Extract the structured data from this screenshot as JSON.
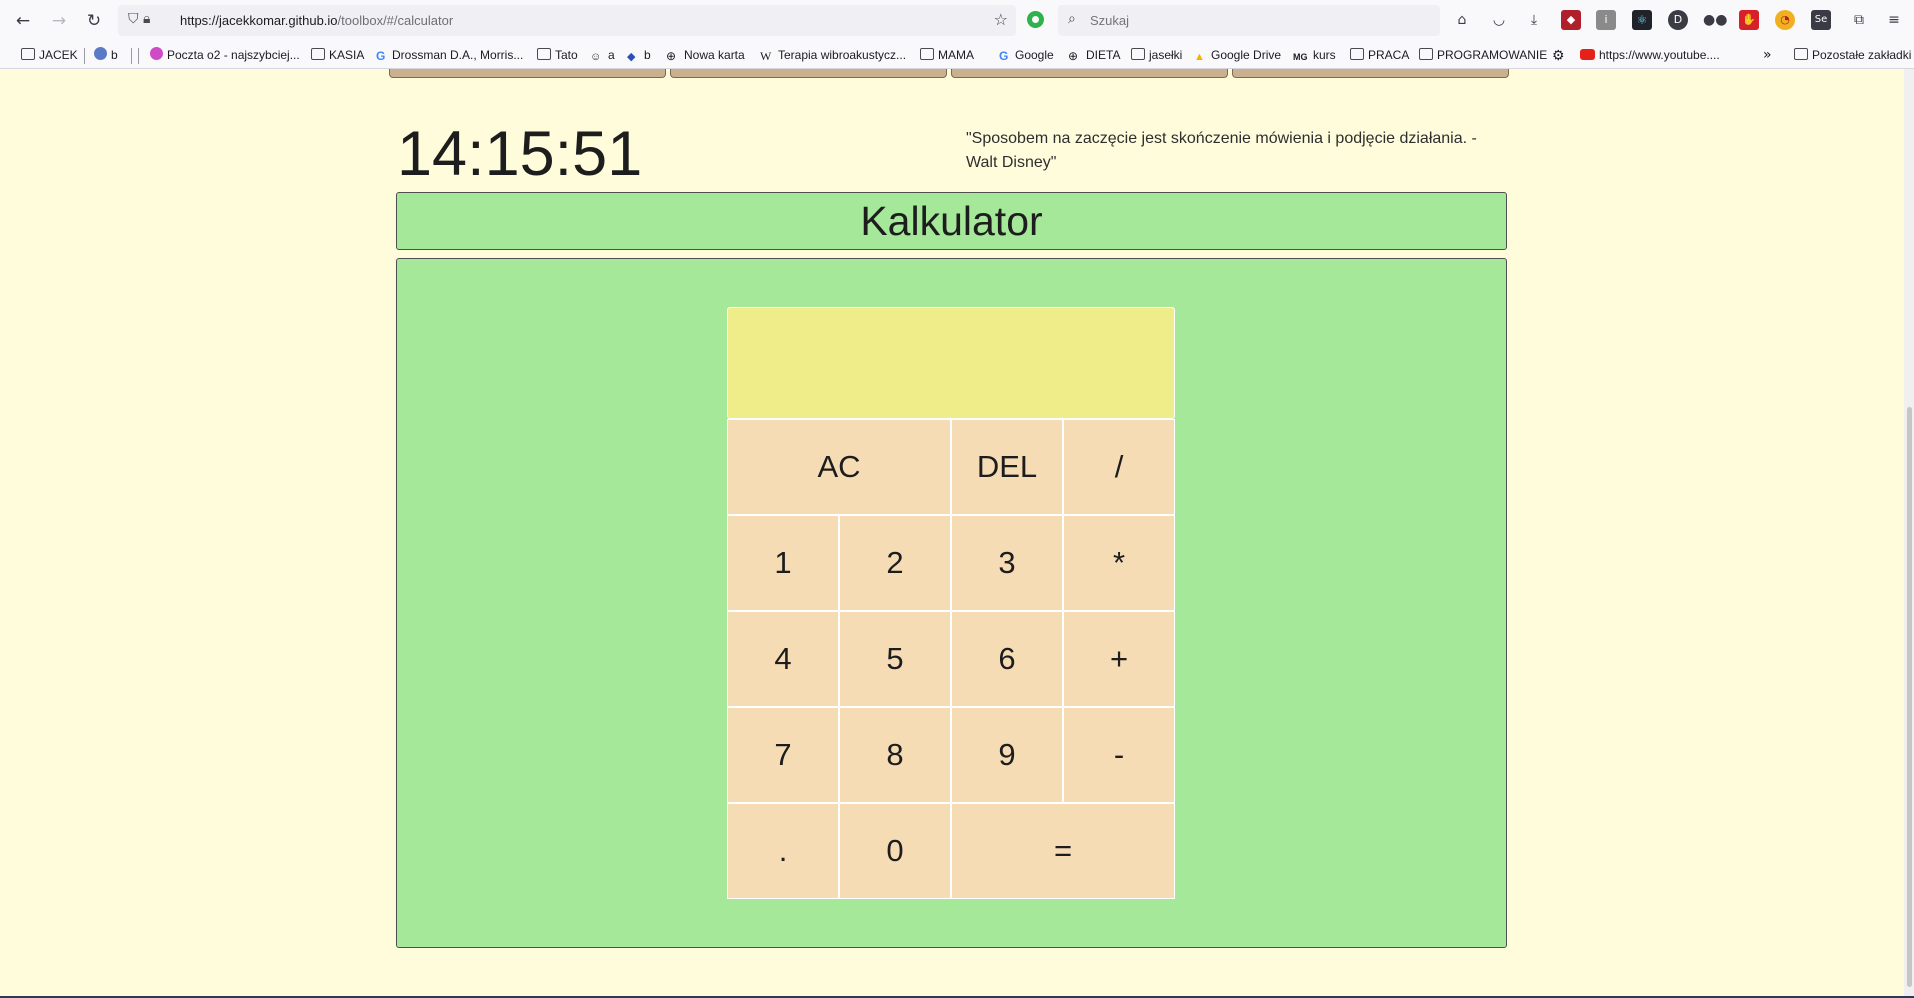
{
  "browser": {
    "url_host": "https://jacekkomar.github.io",
    "url_path": "/toolbox/#/calculator",
    "search_placeholder": "Szukaj",
    "nav_icons": [
      "back-icon",
      "forward-icon",
      "reload-icon"
    ],
    "toolbar_icons": [
      "home-icon",
      "pocket-icon",
      "download-icon",
      "ublock-icon",
      "reader-icon",
      "react-devtools-icon",
      "d-extension-icon",
      "glasses-icon",
      "red-extension-icon",
      "timer-extension-icon",
      "selenium-icon",
      "extensions-icon",
      "menu-icon"
    ]
  },
  "bookmarks": {
    "items": [
      {
        "label": "JACEK",
        "icon": "folder-icon"
      },
      {
        "label": "b",
        "icon": "globe-colored-icon"
      },
      {
        "label": "Poczta o2 - najszybciej...",
        "icon": "o2-icon"
      },
      {
        "label": "KASIA",
        "icon": "folder-icon"
      },
      {
        "label": "Drossman D.A., Morris...",
        "icon": "google-icon"
      },
      {
        "label": "Tato",
        "icon": "folder-icon"
      },
      {
        "label": "a",
        "icon": "face-icon"
      },
      {
        "label": "b",
        "icon": "diamond-icon"
      },
      {
        "label": "Nowa karta",
        "icon": "globe-icon"
      },
      {
        "label": "Terapia wibroakustycz...",
        "icon": "wikipedia-icon"
      },
      {
        "label": "MAMA",
        "icon": "folder-icon"
      },
      {
        "label": "Google",
        "icon": "google-icon"
      },
      {
        "label": "DIETA",
        "icon": "globe-icon"
      },
      {
        "label": "jasełki",
        "icon": "folder-icon"
      },
      {
        "label": "Google Drive",
        "icon": "google-drive-icon"
      },
      {
        "label": "kurs",
        "icon": "mg-icon"
      },
      {
        "label": "PRACA",
        "icon": "folder-icon"
      },
      {
        "label": "PROGRAMOWANIE",
        "icon": "folder-icon"
      },
      {
        "label": "",
        "icon": "gear-icon"
      },
      {
        "label": "https://www.youtube....",
        "icon": "youtube-icon"
      }
    ],
    "overflow_icon": "chevron-double-right-icon",
    "other_label": "Pozostałe zakładki"
  },
  "page": {
    "clock": "14:15:51",
    "quote": "\"Sposobem na zaczęcie jest skończenie mówienia i podjęcie działania. - Walt Disney\"",
    "title": "Kalkulator",
    "display_value": "",
    "keys": {
      "ac": "AC",
      "del": "DEL",
      "divide": "/",
      "k1": "1",
      "k2": "2",
      "k3": "3",
      "multiply": "*",
      "k4": "4",
      "k5": "5",
      "k6": "6",
      "plus": "+",
      "k7": "7",
      "k8": "8",
      "k9": "9",
      "minus": "-",
      "dot": ".",
      "k0": "0",
      "equals": "="
    }
  },
  "colors": {
    "page_bg": "#fffcdc",
    "panel_green": "#a6e89a",
    "display_yellow": "#eeed8a",
    "key_bg": "#f5dcb5"
  }
}
